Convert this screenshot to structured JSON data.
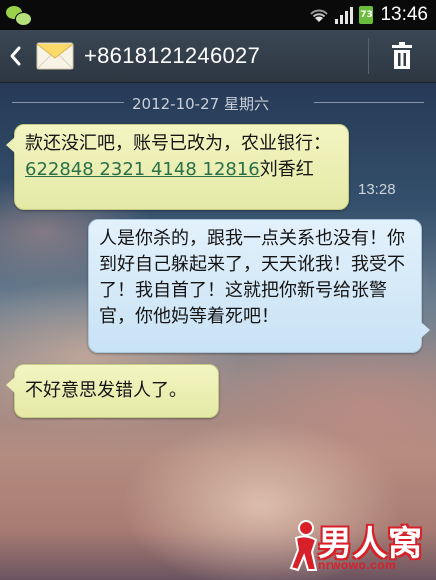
{
  "status_bar": {
    "battery_level": "73",
    "time": "13:46"
  },
  "header": {
    "contact": "+8618121246027"
  },
  "date_divider": "2012-10-27 星期六",
  "messages": [
    {
      "direction": "incoming",
      "text_before": "款还没汇吧，账号已改为，农业银行：",
      "account_link": "622848 2321 4148 12816",
      "text_after": "刘香红",
      "time": "13:28"
    },
    {
      "direction": "outgoing",
      "text": "人是你杀的，跟我一点关系也没有！你到好自己躲起来了，天天讹我！我受不了！我自首了！这就把你新号给张警官，你他妈等着死吧！"
    },
    {
      "direction": "incoming",
      "text": "不好意思发错人了。"
    }
  ],
  "watermark": {
    "text": "男人窝",
    "url": "nrwowo.com"
  },
  "colors": {
    "incoming_bubble": "#eef1b6",
    "outgoing_bubble": "#d3e8f8",
    "header": "#323e4a",
    "link": "#2a6f4a",
    "watermark_red": "#d8202a"
  }
}
